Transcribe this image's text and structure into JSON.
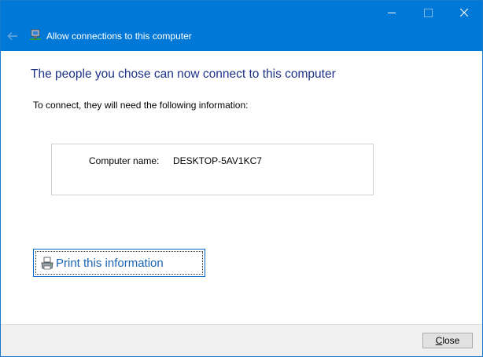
{
  "window": {
    "title": "Allow connections to this computer",
    "controls": {
      "minimize": "minimize",
      "maximize": "maximize",
      "close": "close"
    }
  },
  "main": {
    "heading": "The people you chose can now connect to this computer",
    "instruction": "To connect, they will need the following information:",
    "info": {
      "label": "Computer name:",
      "value": "DESKTOP-5AV1KC7"
    },
    "print_link": "Print this information"
  },
  "footer": {
    "close_label_first": "C",
    "close_label_rest": "lose"
  },
  "colors": {
    "titlebar": "#0078d7",
    "heading": "#1e3287",
    "link": "#1a64b4",
    "footer": "#f0f0f0"
  },
  "icons": {
    "back": "back-arrow-icon",
    "app": "network-computer-icon",
    "print": "printer-icon"
  }
}
